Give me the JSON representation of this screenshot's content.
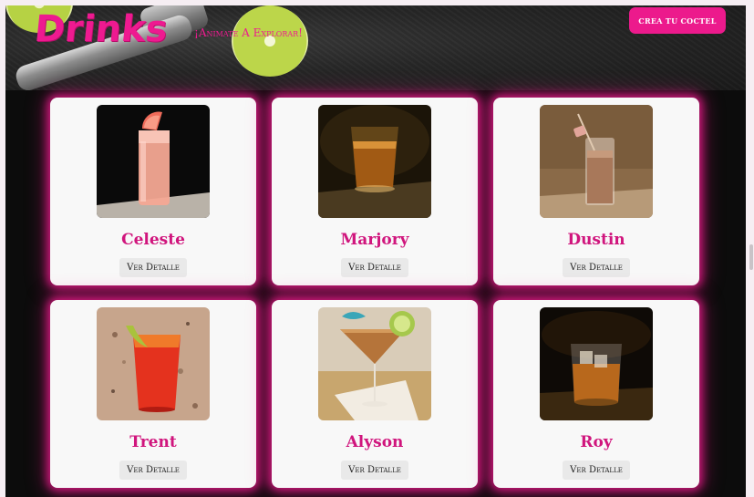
{
  "header": {
    "logo": "Drinks",
    "tagline": "¡Animate A Explorar!",
    "cta_label": "CREA TU COCTEL"
  },
  "colors": {
    "accent": "#ec1a8c",
    "card_title": "#d0157d",
    "background": "#0c0c0c",
    "card_background": "#f8f8f8"
  },
  "cards": [
    {
      "name": "Celeste",
      "button": "Ver Detalle",
      "photo": "pink-highball-drink"
    },
    {
      "name": "Marjory",
      "button": "Ver Detalle",
      "photo": "amber-shot-glass"
    },
    {
      "name": "Dustin",
      "button": "Ver Detalle",
      "photo": "creamy-shot-glass"
    },
    {
      "name": "Trent",
      "button": "Ver Detalle",
      "photo": "red-cocktail-glass"
    },
    {
      "name": "Alyson",
      "button": "Ver Detalle",
      "photo": "martini-glass"
    },
    {
      "name": "Roy",
      "button": "Ver Detalle",
      "photo": "whiskey-rocks-glass"
    }
  ]
}
